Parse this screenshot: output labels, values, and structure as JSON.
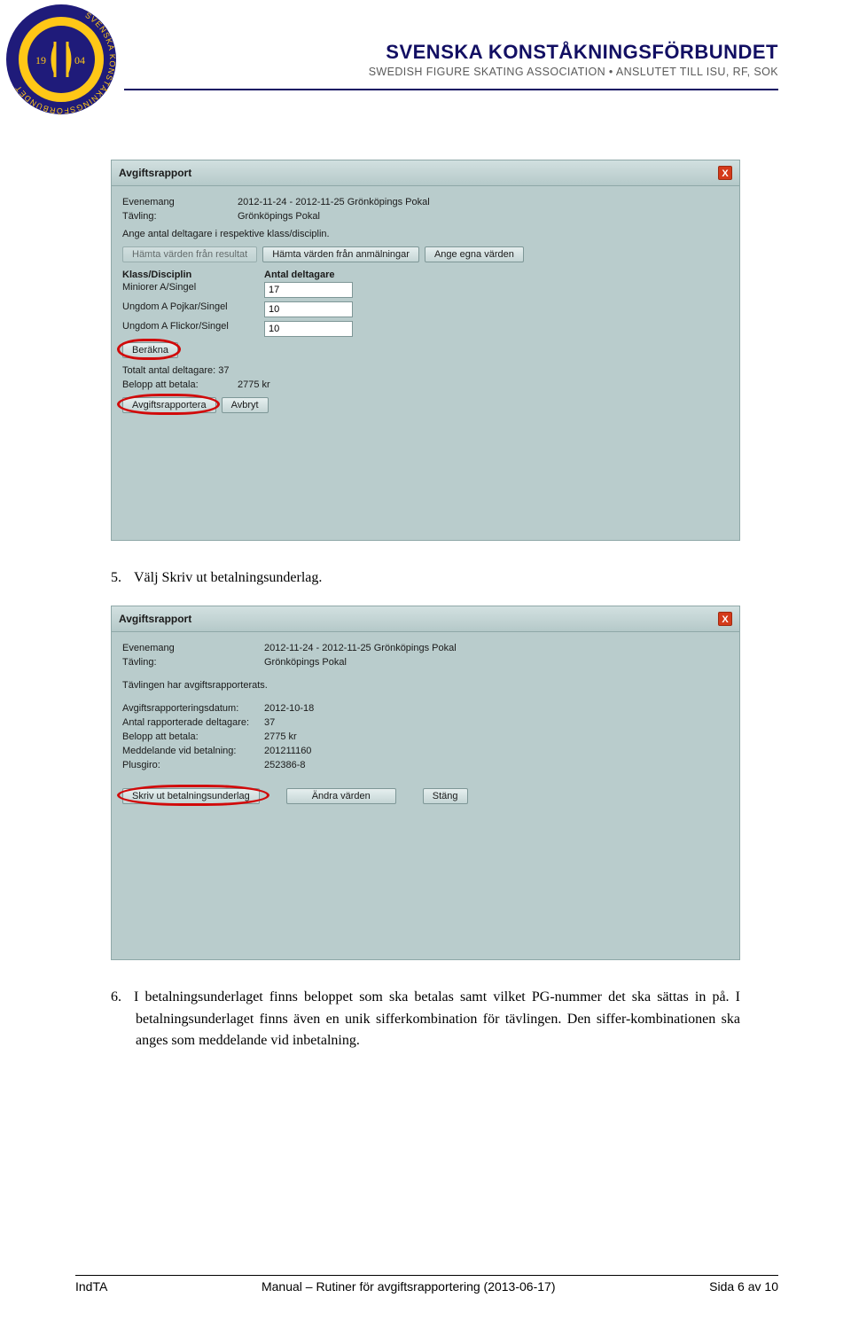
{
  "header": {
    "title": "SVENSKA KONSTÅKNINGSFÖRBUNDET",
    "subtitle": "SWEDISH FIGURE SKATING ASSOCIATION  •  ANSLUTET TILL ISU, RF, SOK",
    "logo_year_left": "19",
    "logo_year_right": "04",
    "logo_ring_text": "SVENSKA KONSTÅKNINGSFÖRBUNDET"
  },
  "panel1": {
    "title": "Avgiftsrapport",
    "close": "X",
    "evenemang_label": "Evenemang",
    "evenemang_value": "2012-11-24 - 2012-11-25 Grönköpings Pokal",
    "tavling_label": "Tävling:",
    "tavling_value": "Grönköpings Pokal",
    "instruction": "Ange antal deltagare i respektive klass/disciplin.",
    "btn_hamta_resultat": "Hämta värden från resultat",
    "btn_hamta_anmal": "Hämta värden från anmälningar",
    "btn_egna": "Ange egna värden",
    "col_klass": "Klass/Disciplin",
    "col_antal": "Antal deltagare",
    "rows": [
      {
        "klass": "Miniorer A/Singel",
        "antal": "17"
      },
      {
        "klass": "Ungdom A Pojkar/Singel",
        "antal": "10"
      },
      {
        "klass": "Ungdom A Flickor/Singel",
        "antal": "10"
      }
    ],
    "btn_berakna": "Beräkna",
    "totalt_label": "Totalt antal deltagare:",
    "totalt_value": "37",
    "belopp_label": "Belopp att betala:",
    "belopp_value": "2775 kr",
    "btn_rapportera": "Avgiftsrapportera",
    "btn_avbryt": "Avbryt"
  },
  "step5": {
    "num": "5.",
    "text": "Välj Skriv ut betalningsunderlag."
  },
  "panel2": {
    "title": "Avgiftsrapport",
    "close": "X",
    "evenemang_label": "Evenemang",
    "evenemang_value": "2012-11-24 - 2012-11-25 Grönköpings Pokal",
    "tavling_label": "Tävling:",
    "tavling_value": "Grönköpings Pokal",
    "status": "Tävlingen har avgiftsrapporterats.",
    "datum_label": "Avgiftsrapporteringsdatum:",
    "datum_value": "2012-10-18",
    "deltagare_label": "Antal rapporterade deltagare:",
    "deltagare_value": "37",
    "belopp_label": "Belopp att betala:",
    "belopp_value": "2775 kr",
    "meddelande_label": "Meddelande vid betalning:",
    "meddelande_value": "201211160",
    "plusgiro_label": "Plusgiro:",
    "plusgiro_value": "252386-8",
    "btn_skriv": "Skriv ut betalningsunderlag",
    "btn_andra": "Ändra värden",
    "btn_stang": "Stäng"
  },
  "step6": {
    "num": "6.",
    "text": "I betalningsunderlaget finns beloppet som ska betalas samt vilket PG-nummer det ska sättas in på. I betalningsunderlaget finns även en unik sifferkombination för tävlingen. Den siffer-kombinationen ska anges som meddelande vid inbetalning."
  },
  "footer": {
    "left": "IndTA",
    "center": "Manual – Rutiner för avgiftsrapportering (2013-06-17)",
    "right": "Sida 6 av 10"
  }
}
